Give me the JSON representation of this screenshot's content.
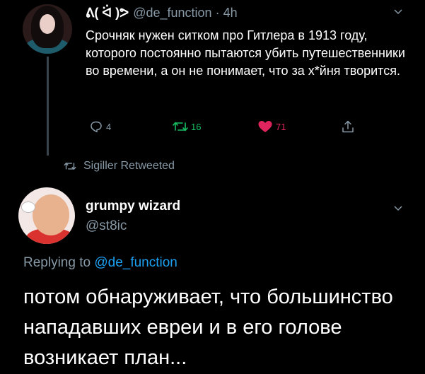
{
  "tweet1": {
    "display_name": "ᕕ( ᐛ )ᕗ",
    "handle": "@de_function",
    "separator": "·",
    "time": "4h",
    "text": "Срочняк нужен ситком про Гитлера в 1913 году, которого постоянно пытаются убить путешественники во времени, а он не понимает, что за х*йня творится.",
    "actions": {
      "replies": "4",
      "retweets": "16",
      "likes": "71"
    },
    "icons": {
      "reply": "comment-bubble-icon",
      "retweet": "retweet-arrows-icon",
      "like": "heart-icon",
      "share": "share-upload-icon",
      "menu": "chevron-down-icon"
    }
  },
  "retweeted_by": {
    "text": "Sigiller Retweeted",
    "icon": "retweet-arrows-icon"
  },
  "tweet2": {
    "display_name": "grumpy wizard",
    "handle": "@st8ic",
    "replying_prefix": "Replying to",
    "replying_to": "@de_function",
    "text": "потом обнаруживает, что большинство нападавших евреи и в его голове возникает план...",
    "icons": {
      "menu": "chevron-down-icon"
    }
  },
  "colors": {
    "background": "#000000",
    "text": "#ffffff",
    "muted": "#8899a6",
    "link": "#1da1f2",
    "retweet_green": "#17bf63",
    "like_red": "#e0245e"
  }
}
